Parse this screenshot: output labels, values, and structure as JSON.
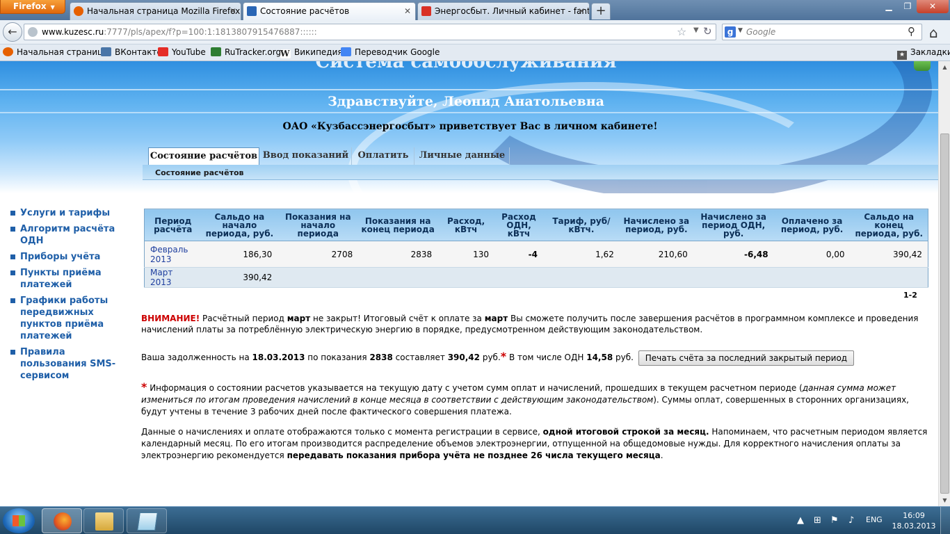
{
  "browser": {
    "menu_label": "Firefox",
    "tabs": [
      {
        "label": "Начальная страница Mozilla Firefox",
        "icon": "firefox-icon",
        "color": "#e66000"
      },
      {
        "label": "Состояние расчётов",
        "icon": "apex-icon",
        "color": "#2a66b5"
      },
      {
        "label": "Энергосбыт. Личный кабинет - fant...",
        "icon": "gmail-icon",
        "color": "#d93025"
      }
    ],
    "url_host": "www.kuzesc.ru",
    "url_rest": ":7777/pls/apex/f?p=100:1:1813807915476887::::::",
    "search_placeholder": "Google",
    "bookmarks": [
      {
        "label": "Начальная страница",
        "icon": "firefox-icon",
        "color": "#e66000"
      },
      {
        "label": "ВКонтакте",
        "icon": "vk-icon",
        "color": "#4a76a8"
      },
      {
        "label": "YouTube",
        "icon": "youtube-icon",
        "color": "#e52d27"
      },
      {
        "label": "RuTracker.org",
        "icon": "rutracker-icon",
        "color": "#2e7d32"
      },
      {
        "label": "Википедия",
        "icon": "wikipedia-icon",
        "color": "#222222"
      },
      {
        "label": "Переводчик Google",
        "icon": "google-translate-icon",
        "color": "#4285f4"
      }
    ],
    "bookmarks_menu": "Закладки"
  },
  "header": {
    "site_title": "Система самообслуживания",
    "greeting": "Здравствуйте, Леонид Анатольевна",
    "welcome": "ОАО «Кузбассэнергосбыт» приветствует Вас в личном кабинете!"
  },
  "tabs": {
    "items": [
      "Состояние расчётов",
      "Ввод показаний",
      "Оплатить",
      "Личные данные"
    ],
    "breadcrumb": "Состояние расчётов"
  },
  "sidebar": {
    "items": [
      "Услуги и тарифы",
      "Алгоритм расчёта ОДН",
      "Приборы учёта",
      "Пункты приёма платежей",
      "Графики работы передвижных пунктов приёма платежей",
      "Правила пользования SMS-сервисом"
    ]
  },
  "table": {
    "headers": [
      "Период расчёта",
      "Сальдо на начало периода, руб.",
      "Показания на начало периода",
      "Показания на конец периода",
      "Расход, кВтч",
      "Расход ОДН, кВтч",
      "Тариф, руб/кВтч.",
      "Начислено за период, руб.",
      "Начислено за период ОДН, руб.",
      "Оплачено за период, руб.",
      "Сальдо на конец периода, руб."
    ],
    "rows": [
      [
        "Февраль 2013",
        "186,30",
        "2708",
        "2838",
        "130",
        "-4",
        "1,62",
        "210,60",
        "-6,48",
        "0,00",
        "390,42"
      ],
      [
        "Март 2013",
        "390,42",
        "",
        "",
        "",
        "",
        "",
        "",
        "",
        "",
        ""
      ]
    ],
    "pager": "1-2"
  },
  "notice": {
    "attention": "ВНИМАНИЕ!",
    "t1": " Расчётный период ",
    "b1": "март",
    "t2": " не закрыт! Итоговый счёт к оплате за ",
    "b2": "март",
    "t3": " Вы сможете получить после завершения расчётов в программном комплексе и проведения начислений платы за потреблённую электрическую энергию в порядке, предусмотренном действующим законодательством."
  },
  "debt": {
    "t1": "Ваша задолженность на ",
    "date": "18.03.2013",
    "t2": " по показания ",
    "reading": "2838",
    "t3": " составляет ",
    "amount": "390,42",
    "t4": " руб.",
    "star": "*",
    "t5": " В том числе ОДН ",
    "odn": "14,58",
    "t6": " руб.",
    "print_button": "Печать счёта за последний закрытый период"
  },
  "info": {
    "star": "*",
    "t1": " Информация о состоянии расчетов указывается на текущую дату с учетом сумм оплат и начислений, прошедших в текущем расчетном периоде (",
    "italic": "данная сумма может измениться по итогам проведения начислений в конце месяца в соответствии с действующим законодательством",
    "t2": "). Суммы оплат, совершенных в сторонних организациях, будут учтены в течение 3 рабочих дней после фактического совершения платежа."
  },
  "note": {
    "t1": "Данные о начислениях и оплате отображаются только с момента регистрации в сервисе, ",
    "b1": "одной итоговой строкой за месяц.",
    "t2": " Напоминаем, что расчетным периодом является календарный месяц. По его итогам производится распределение объемов электроэнергии, отпущенной на общедомовые нужды. Для корректного начисления оплаты за электроэнергию рекомендуется ",
    "b2": "передавать показания прибора учёта не позднее 26 числа текущего месяца",
    "t3": "."
  },
  "taskbar": {
    "lang": "ENG",
    "time": "16:09",
    "date": "18.03.2013"
  }
}
